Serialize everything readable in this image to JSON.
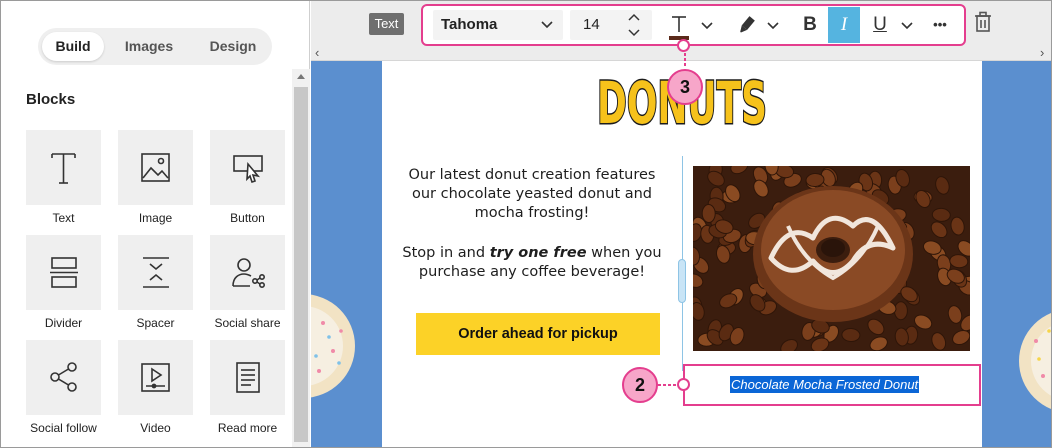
{
  "tabs": {
    "build": "Build",
    "images": "Images",
    "design": "Design"
  },
  "blocks_title": "Blocks",
  "blocks": [
    {
      "label": "Text",
      "icon": "text-icon"
    },
    {
      "label": "Image",
      "icon": "image-icon"
    },
    {
      "label": "Button",
      "icon": "button-icon"
    },
    {
      "label": "Divider",
      "icon": "divider-icon"
    },
    {
      "label": "Spacer",
      "icon": "spacer-icon"
    },
    {
      "label": "Social share",
      "icon": "social-share-icon"
    },
    {
      "label": "Social follow",
      "icon": "social-follow-icon"
    },
    {
      "label": "Video",
      "icon": "video-icon"
    },
    {
      "label": "Read more",
      "icon": "read-more-icon"
    }
  ],
  "toolbar": {
    "badge": "Text",
    "font": "Tahoma",
    "size": "14",
    "bold": "B",
    "italic": "I",
    "underline": "U",
    "more": "•••"
  },
  "email": {
    "logo": "DONUTS",
    "paragraph1": "Our latest donut creation features our chocolate yeasted donut and mocha frosting!",
    "p2_before": "Stop in and ",
    "p2_emph": "try one free",
    "p2_after": " when you purchase any coffee beverage!",
    "cta": "Order ahead for pickup",
    "caption": "Chocolate Mocha Frosted Donut"
  },
  "callouts": {
    "toolbar": "3",
    "caption": "2"
  },
  "colors": {
    "highlight": "#e43e8e",
    "cta": "#fcd227",
    "canvas": "#5b8fcf",
    "selection": "#0b66d6",
    "italic_active": "#55b4e0"
  }
}
